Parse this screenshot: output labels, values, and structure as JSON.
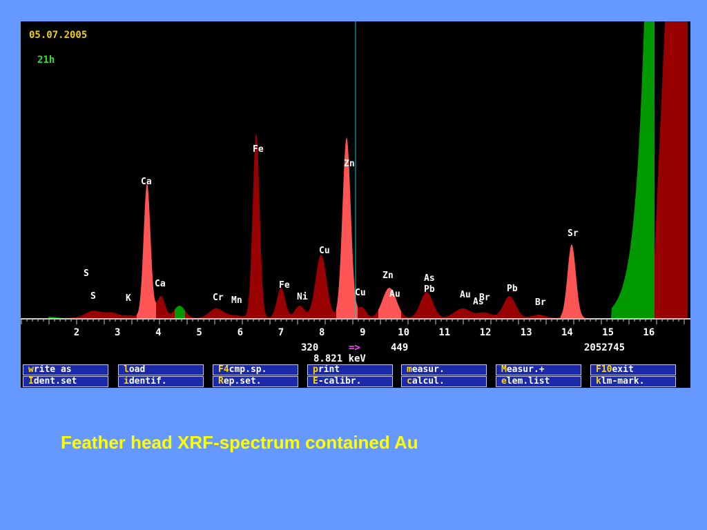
{
  "header": {
    "date": "05.07.2005",
    "time": "21h"
  },
  "readout": {
    "cursor_from": "320",
    "arrow": "=>",
    "cursor_to": "449",
    "energy": "8.821 keV",
    "total_counts": "2052745"
  },
  "axis": {
    "ticks": [
      "2",
      "3",
      "4",
      "5",
      "6",
      "7",
      "8",
      "9",
      "10",
      "11",
      "12",
      "13",
      "14",
      "15",
      "16"
    ]
  },
  "peak_labels": [
    "Ca",
    "Fe",
    "Zn",
    "Cu",
    "S",
    "S",
    "K",
    "Ca",
    "Cr",
    "Mn",
    "Fe",
    "Ni",
    "Cu",
    "Zn",
    "Au",
    "As",
    "Pb",
    "Au",
    "Br",
    "As",
    "Pb",
    "Br",
    "Sr"
  ],
  "function_keys": {
    "row1": [
      {
        "hk": "w",
        "rest": "rite as"
      },
      {
        "hk": "l",
        "rest": "oad"
      },
      {
        "hk": "F4",
        "rest": "cmp.sp."
      },
      {
        "hk": "p",
        "rest": "rint"
      },
      {
        "hk": "m",
        "rest": "easur."
      },
      {
        "hk": "M",
        "rest": "easur.+"
      },
      {
        "hk": "F10",
        "rest": "exit"
      }
    ],
    "row2": [
      {
        "hk": "I",
        "rest": "dent.set"
      },
      {
        "hk": "i",
        "rest": "dentif."
      },
      {
        "hk": "R",
        "rest": "ep.set."
      },
      {
        "hk": "E",
        "rest": "-calibr."
      },
      {
        "hk": "c",
        "rest": "alcul."
      },
      {
        "hk": "e",
        "rest": "lem.list"
      },
      {
        "hk": "k",
        "rest": "lm-mark."
      }
    ]
  },
  "caption": "Feather head XRF-spectrum contained Au",
  "colors": {
    "background": "#6699ff",
    "peak_dark": "#990000",
    "peak_light": "#ff5555",
    "bremsstrahlung": "#009900",
    "cursor_line": "#00cccc",
    "label_text": "#ffffff"
  }
}
